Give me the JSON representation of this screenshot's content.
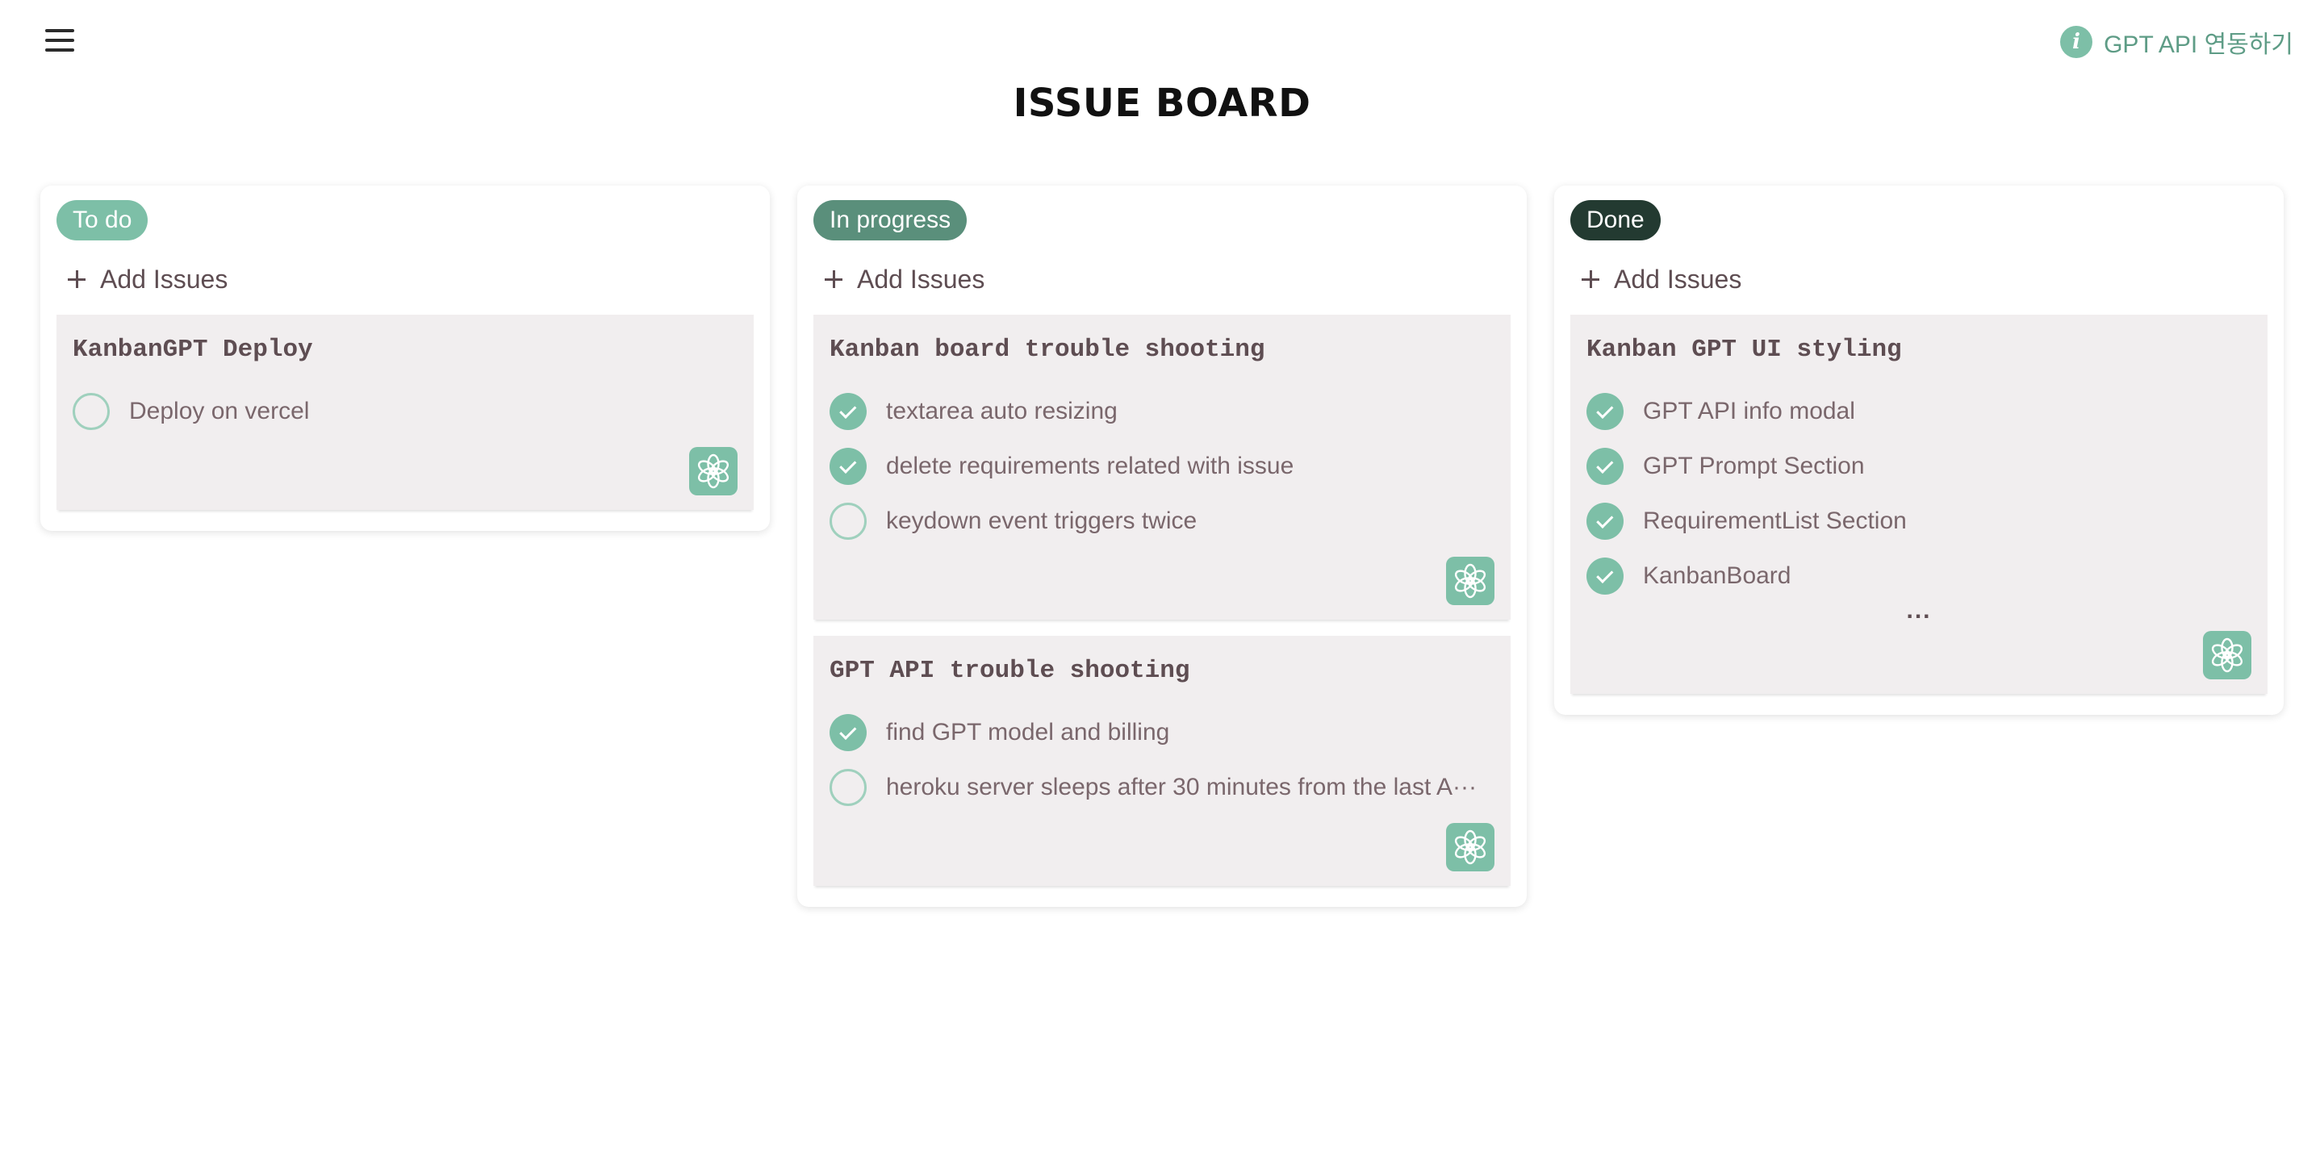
{
  "header": {
    "menu_icon": "hamburger-icon",
    "info_icon": "info-icon",
    "info_glyph": "i",
    "gpt_link_label": "GPT API 연동하기",
    "title": "ISSUE BOARD"
  },
  "colors": {
    "accent": "#7dbfa7",
    "in_progress": "#5a8f7b",
    "done": "#233a31",
    "card_bg": "#f1eeef",
    "text": "#5e4d52"
  },
  "columns": [
    {
      "status": "To do",
      "add_label": "Add Issues",
      "cards": [
        {
          "title": "KanbanGPT Deploy",
          "requirements": [
            {
              "text": "Deploy on vercel",
              "done": false
            }
          ]
        }
      ]
    },
    {
      "status": "In progress",
      "add_label": "Add Issues",
      "cards": [
        {
          "title": "Kanban board trouble shooting",
          "requirements": [
            {
              "text": "textarea auto resizing",
              "done": true
            },
            {
              "text": "delete requirements related with issue",
              "done": true
            },
            {
              "text": "keydown event triggers twice",
              "done": false
            }
          ]
        },
        {
          "title": "GPT API trouble shooting",
          "requirements": [
            {
              "text": "find GPT model and billing",
              "done": true
            },
            {
              "text": "heroku server sleeps after 30 minutes from the last A···",
              "done": false
            }
          ]
        }
      ]
    },
    {
      "status": "Done",
      "add_label": "Add Issues",
      "cards": [
        {
          "title": "Kanban GPT UI styling",
          "requirements": [
            {
              "text": "GPT API info modal",
              "done": true
            },
            {
              "text": "GPT Prompt Section",
              "done": true
            },
            {
              "text": "RequirementList Section",
              "done": true
            },
            {
              "text": "KanbanBoard",
              "done": true
            }
          ],
          "more": "..."
        }
      ]
    }
  ],
  "icons": {
    "add": "plus-icon",
    "gpt": "openai-logo-icon",
    "done": "check-circle-icon",
    "open": "empty-circle-icon"
  }
}
